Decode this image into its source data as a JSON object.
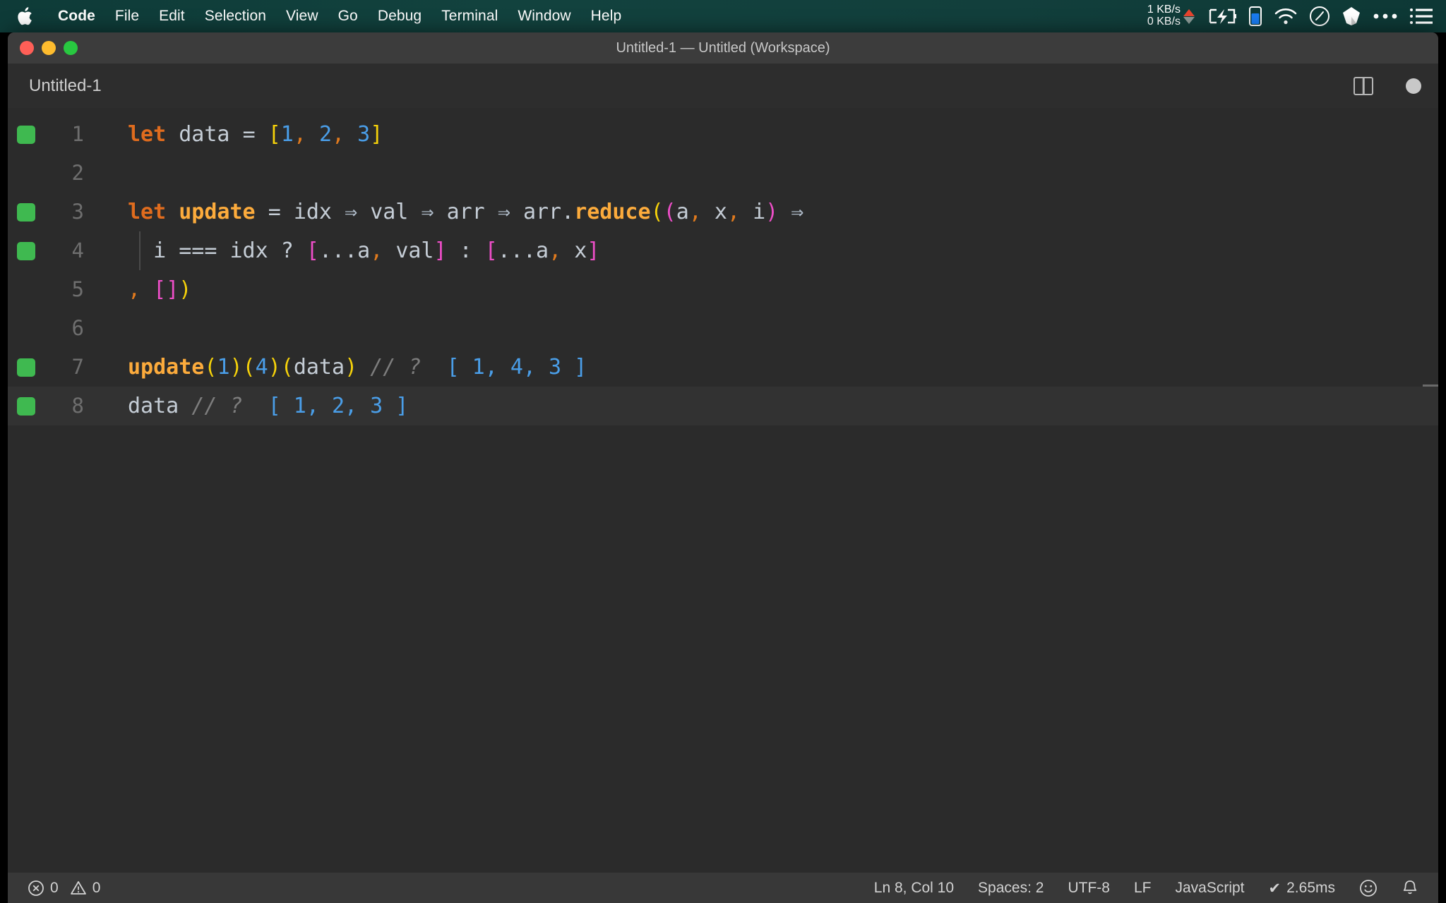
{
  "menubar": {
    "apple_icon": "apple-logo",
    "items": [
      {
        "label": "Code",
        "bold": true
      },
      {
        "label": "File",
        "bold": false
      },
      {
        "label": "Edit",
        "bold": false
      },
      {
        "label": "Selection",
        "bold": false
      },
      {
        "label": "View",
        "bold": false
      },
      {
        "label": "Go",
        "bold": false
      },
      {
        "label": "Debug",
        "bold": false
      },
      {
        "label": "Terminal",
        "bold": false
      },
      {
        "label": "Window",
        "bold": false
      },
      {
        "label": "Help",
        "bold": false
      }
    ],
    "status": {
      "net_up": "1 KB/s",
      "net_down": "0 KB/s",
      "icons": [
        "battery-charging-icon",
        "battery-level-icon",
        "wifi-icon",
        "clock-icon",
        "dropbox-icon",
        "ellipsis-icon",
        "list-menu-icon"
      ]
    }
  },
  "window": {
    "title": "Untitled-1 — Untitled (Workspace)",
    "traffic_lights": [
      "close-button",
      "minimize-button",
      "maximize-button"
    ]
  },
  "tabbar": {
    "tabs": [
      {
        "label": "Untitled-1",
        "active": true,
        "dirty": true
      }
    ],
    "actions": [
      "split-editor-icon",
      "unsaved-dot-indicator"
    ]
  },
  "editor": {
    "lines": [
      {
        "num": "1",
        "marked": true,
        "active": false
      },
      {
        "num": "2",
        "marked": false,
        "active": false
      },
      {
        "num": "3",
        "marked": true,
        "active": false
      },
      {
        "num": "4",
        "marked": true,
        "active": false
      },
      {
        "num": "5",
        "marked": false,
        "active": false
      },
      {
        "num": "6",
        "marked": false,
        "active": false
      },
      {
        "num": "7",
        "marked": true,
        "active": false
      },
      {
        "num": "8",
        "marked": true,
        "active": true
      }
    ],
    "code_text": {
      "line1": "let data = [1, 2, 3]",
      "line3": "let update = idx ⇒ val ⇒ arr ⇒ arr.reduce((a, x, i) ⇒",
      "line4": "  i === idx ? [...a, val] : [...a, x]",
      "line5": ", [])",
      "line7": "update(1)(4)(data) // ? [ 1, 4, 3 ]",
      "line8": "data // ? [ 1, 2, 3 ]"
    },
    "tokens": {
      "kw_let": "let",
      "id_data": "data",
      "eq": "=",
      "brk_open": "[",
      "brk_close": "]",
      "n1": "1",
      "n2": "2",
      "n3": "3",
      "n4": "4",
      "comma": ",",
      "fn_update": "update",
      "id_idx": "idx",
      "id_val": "val",
      "id_arr": "arr",
      "arrow": "⇒",
      "dot": ".",
      "fn_reduce": "reduce",
      "paren_open": "(",
      "paren_close": ")",
      "id_a": "a",
      "id_x": "x",
      "id_i": "i",
      "triple_eq": "===",
      "question": "?",
      "colon": ":",
      "spread": "...",
      "comment_marker": "// ?",
      "result_74": "[ 1, 4, 3 ]",
      "result_8": "[ 1, 2, 3 ]"
    },
    "colors": {
      "background": "#2b2b2b",
      "keyword": "#e06c1e",
      "function": "#fcab3c",
      "variable": "#c5cdd6",
      "number": "#4a9ee8",
      "bracket_yellow": "#f6d20a",
      "bracket_pink": "#ee4ec8",
      "comment": "#7d7d7d",
      "coverage_green": "#3fb950"
    }
  },
  "statusbar": {
    "errors_icon": "error-circle-icon",
    "errors": "0",
    "warnings_icon": "warning-triangle-icon",
    "warnings": "0",
    "cursor_position": "Ln 8, Col 10",
    "indentation": "Spaces: 2",
    "encoding": "UTF-8",
    "eol": "LF",
    "language": "JavaScript",
    "runtime_check": "✔",
    "runtime": "2.65ms",
    "feedback_icon": "smiley-icon",
    "notifications_icon": "bell-icon"
  }
}
